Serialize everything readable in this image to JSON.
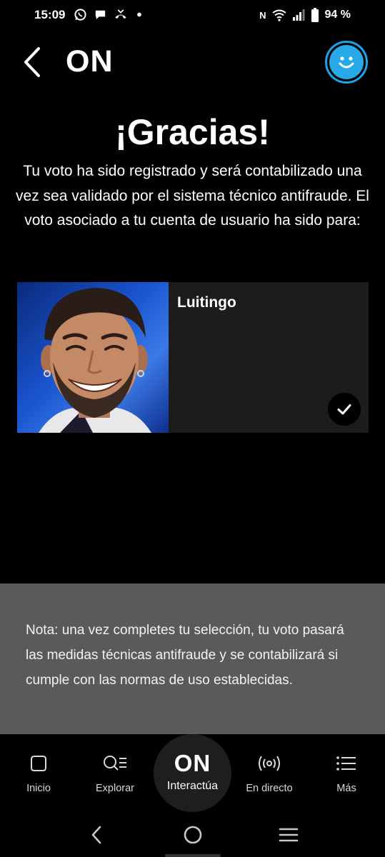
{
  "status_bar": {
    "time": "15:09",
    "left_icons": [
      "whatsapp-icon",
      "chat-bubble-icon",
      "missed-call-icon",
      "dot-icon"
    ],
    "nfc_glyph": "N",
    "right_icons": [
      "nfc-icon",
      "wifi-icon",
      "signal-icon",
      "battery-icon"
    ],
    "battery": "94 %"
  },
  "app_bar": {
    "title": "ON",
    "back_icon": "chevron-left-icon",
    "profile_icon": "smiley-face-icon",
    "accent_color": "#1aa3e8"
  },
  "confirmation": {
    "title": "¡Gracias!",
    "message": "Tu voto ha sido registrado y será contabilizado una vez sea validado por el sistema técnico antifraude. El voto asociado a tu cuenta de usuario ha sido para:"
  },
  "vote_card": {
    "candidate_name": "Luitingo",
    "selected": true,
    "check_icon": "checkmark-icon"
  },
  "note": {
    "text": "Nota: una vez completes tu selección, tu voto pasará las medidas técnicas antifraude y se contabilizará si cumple con las normas de uso establecidas."
  },
  "bottom_nav": {
    "items": [
      {
        "label": "Inicio",
        "icon": "home-hexagon-icon"
      },
      {
        "label": "Explorar",
        "icon": "search-list-icon"
      },
      {
        "label": "Interactúa",
        "icon": "on-logo-icon",
        "logo_text": "ON",
        "active": true
      },
      {
        "label": "En directo",
        "icon": "broadcast-icon"
      },
      {
        "label": "Más",
        "icon": "menu-list-icon"
      }
    ]
  },
  "system_nav": {
    "buttons": [
      "back-icon",
      "home-circle-icon",
      "recents-icon"
    ]
  }
}
